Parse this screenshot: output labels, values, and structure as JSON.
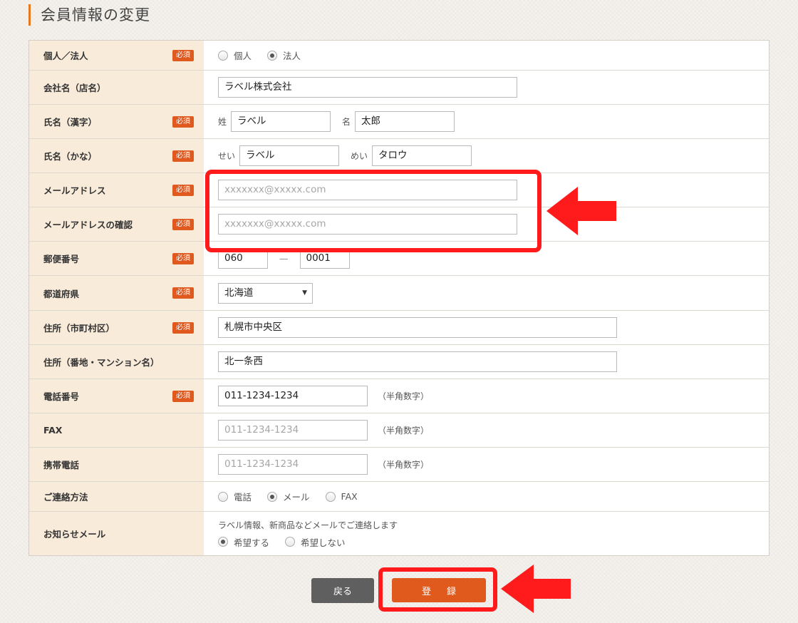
{
  "page_title": "会員情報の変更",
  "required_badge": "必須",
  "rows": {
    "entity": {
      "label": "個人／法人",
      "opt1": "個人",
      "opt2": "法人",
      "selected": "法人"
    },
    "company": {
      "label": "会社名（店名）",
      "value": "ラベル株式会社"
    },
    "name_kanji": {
      "label": "氏名（漢字）",
      "sei_label": "姓",
      "sei": "ラベル",
      "mei_label": "名",
      "mei": "太郎"
    },
    "name_kana": {
      "label": "氏名（かな）",
      "sei_label": "せい",
      "sei": "ラベル",
      "mei_label": "めい",
      "mei": "タロウ"
    },
    "email": {
      "label": "メールアドレス",
      "placeholder": "xxxxxxx@xxxxx.com"
    },
    "email_confirm": {
      "label": "メールアドレスの確認",
      "placeholder": "xxxxxxx@xxxxx.com"
    },
    "postal": {
      "label": "郵便番号",
      "part1": "060",
      "sep": "—",
      "part2": "0001"
    },
    "prefecture": {
      "label": "都道府県",
      "value": "北海道"
    },
    "address1": {
      "label": "住所（市町村区）",
      "value": "札幌市中央区"
    },
    "address2": {
      "label": "住所（番地・マンション名）",
      "value": "北一条西"
    },
    "phone": {
      "label": "電話番号",
      "value": "011-1234-1234",
      "hint": "（半角数字）"
    },
    "fax": {
      "label": "FAX",
      "placeholder": "011-1234-1234",
      "hint": "（半角数字）"
    },
    "mobile": {
      "label": "携帯電話",
      "placeholder": "011-1234-1234",
      "hint": "（半角数字）"
    },
    "contact": {
      "label": "ご連絡方法",
      "opt1": "電話",
      "opt2": "メール",
      "opt3": "FAX",
      "selected": "メール"
    },
    "newsletter": {
      "label": "お知らせメール",
      "description": "ラベル情報、新商品などメールでご連絡します",
      "opt1": "希望する",
      "opt2": "希望しない",
      "selected": "希望する"
    }
  },
  "buttons": {
    "back": "戻る",
    "submit": "登録"
  },
  "colors": {
    "accent": "#e05a1e",
    "label_bg": "#f8ebda",
    "annotation": "#ff1b1b"
  }
}
